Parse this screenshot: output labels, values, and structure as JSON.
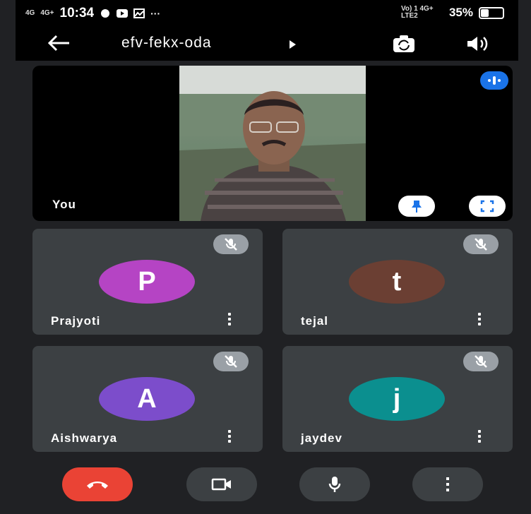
{
  "status_bar": {
    "signal_1": "4G",
    "signal_2": "4G+",
    "time": "10:34",
    "network": "Vo) 1 4G+ LTE2",
    "battery": "35%",
    "battery_level": 0.35
  },
  "top_bar": {
    "meeting_code": "efv-fekx-oda",
    "back_icon": "arrow-left",
    "switch_camera_icon": "switch-camera",
    "speaker_icon": "speaker"
  },
  "self_view": {
    "label": "You",
    "pin_icon": "pin",
    "fullscreen_icon": "fullscreen",
    "audio_icon": "audio-level"
  },
  "participants": [
    {
      "name": "Prajyoti",
      "initial": "P",
      "color": "#b544c4",
      "muted": true
    },
    {
      "name": "tejal",
      "initial": "t",
      "color": "#6b3f33",
      "muted": true
    },
    {
      "name": "Aishwarya",
      "initial": "A",
      "color": "#7c4dcb",
      "muted": true
    },
    {
      "name": "jaydev",
      "initial": "j",
      "color": "#0b8f8f",
      "muted": true
    }
  ],
  "controls": {
    "end_call_icon": "call-end",
    "camera_icon": "videocam",
    "mic_icon": "mic",
    "more_icon": "more-vert"
  },
  "colors": {
    "end_call": "#ea4335",
    "accent": "#1a73e8",
    "tile_bg": "#3c4043",
    "background": "#202124"
  }
}
